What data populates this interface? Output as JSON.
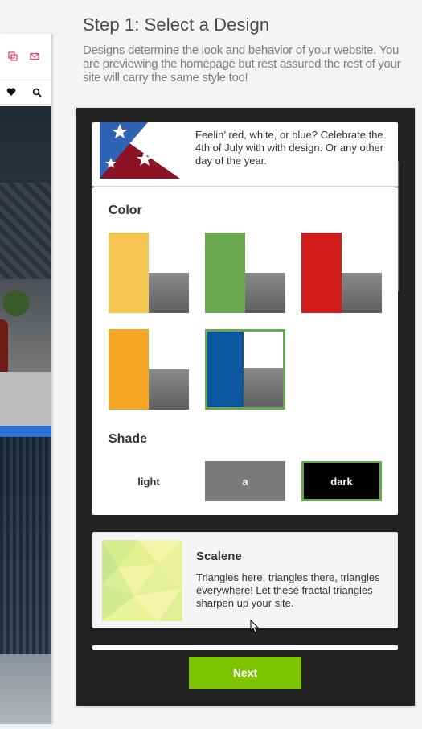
{
  "header": {
    "title": "Step 1: Select a Design",
    "description": "Designs determine the look and behavior of your website. You are previewing the homepage but rest assured the rest of your site will carry the same style too!"
  },
  "preview": {
    "icons": [
      "copy-icon",
      "mail-icon",
      "heart-icon",
      "search-icon"
    ]
  },
  "designs": {
    "patriot": {
      "description": "Feelin’ red, white, or blue? Celebrate the 4th of July with with design. Or any other day of the year."
    },
    "scalene": {
      "title": "Scalene",
      "description": "Triangles here, triangles there, triangles everywhere! Let these fractal triangles sharpen up your site."
    }
  },
  "options": {
    "color_label": "Color",
    "colors": [
      {
        "name": "yellow",
        "hex": "#f5c451",
        "selected": false
      },
      {
        "name": "green",
        "hex": "#6aa84f",
        "selected": false
      },
      {
        "name": "red",
        "hex": "#d21c1c",
        "selected": false
      },
      {
        "name": "orange",
        "hex": "#f5a623",
        "selected": false
      },
      {
        "name": "blue",
        "hex": "#0b58a0",
        "selected": true
      }
    ],
    "shade_label": "Shade",
    "shades": [
      {
        "label": "light",
        "selected": false
      },
      {
        "label": "a",
        "selected": false
      },
      {
        "label": "dark",
        "selected": true
      }
    ]
  },
  "footer": {
    "next_label": "Next"
  },
  "colors": {
    "accent": "#6aa84f",
    "next_button": "#7dc400",
    "panel": "#222222"
  }
}
